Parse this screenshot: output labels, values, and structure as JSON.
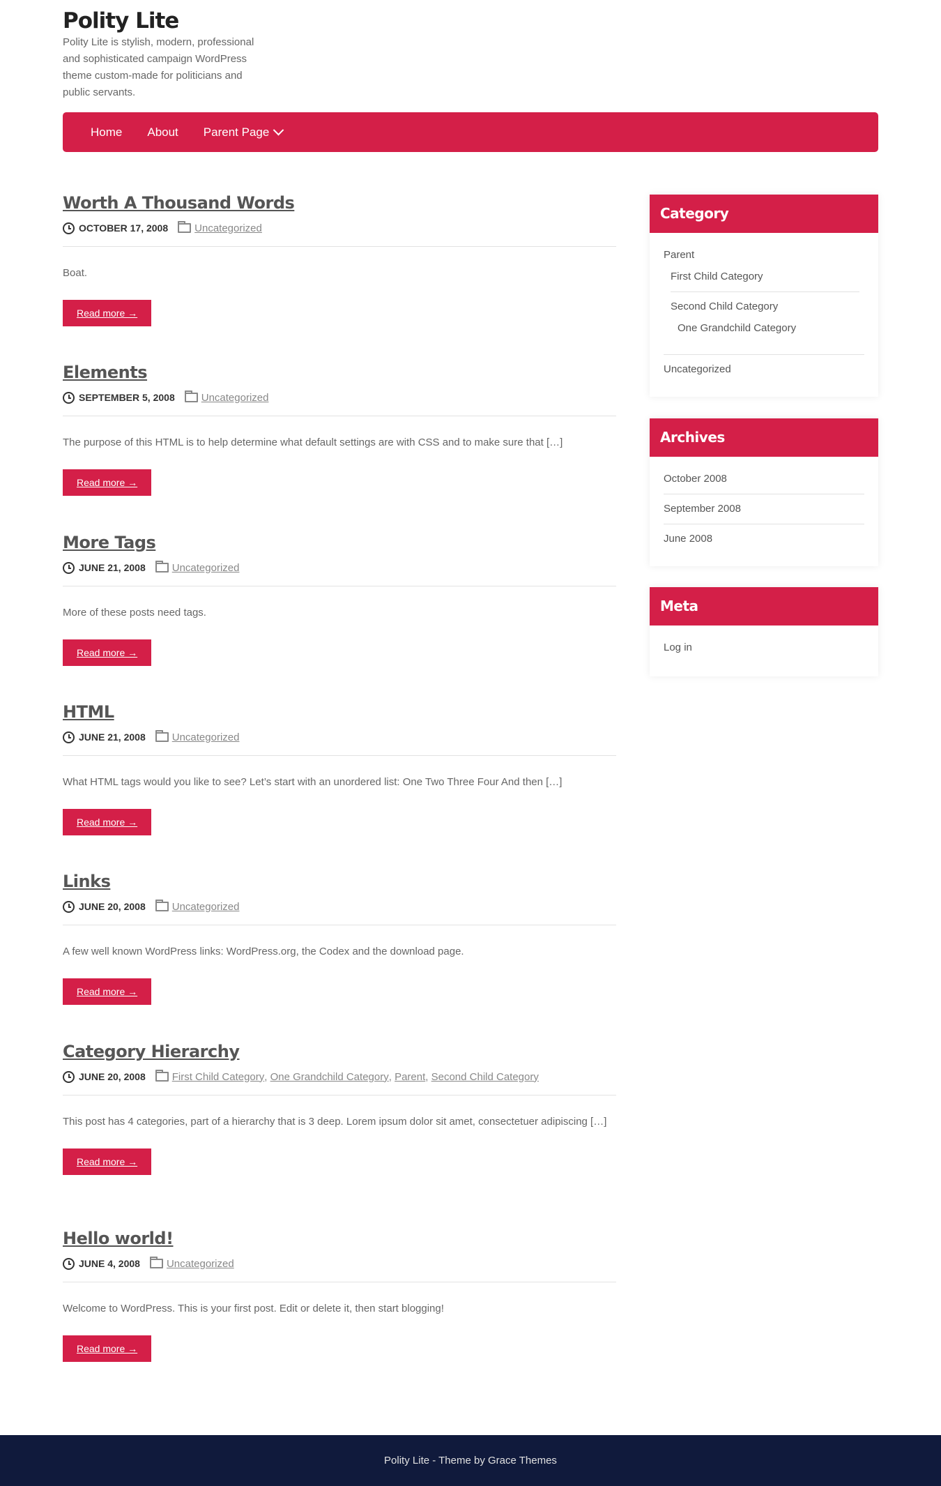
{
  "site": {
    "title": "Polity Lite",
    "description": "Polity Lite is stylish, modern, professional and sophisticated campaign WordPress theme custom-made for politicians and public servants."
  },
  "nav": {
    "items": [
      {
        "label": "Home"
      },
      {
        "label": "About"
      },
      {
        "label": "Parent Page"
      }
    ]
  },
  "posts": [
    {
      "title": "Worth A Thousand Words",
      "date": "OCTOBER 17, 2008",
      "categories": [
        "Uncategorized"
      ],
      "excerpt": "Boat.",
      "read_more": "Read more →"
    },
    {
      "title": "Elements",
      "date": "SEPTEMBER 5, 2008",
      "categories": [
        "Uncategorized"
      ],
      "excerpt": "The purpose of this HTML is to help determine what default settings are with CSS and to make sure that […]",
      "read_more": "Read more →"
    },
    {
      "title": "More Tags",
      "date": "JUNE 21, 2008",
      "categories": [
        "Uncategorized"
      ],
      "excerpt": "More of these posts need tags.",
      "read_more": "Read more →"
    },
    {
      "title": "HTML",
      "date": "JUNE 21, 2008",
      "categories": [
        "Uncategorized"
      ],
      "excerpt": "What HTML tags would you like to see? Let’s start with an unordered list: One Two Three Four And then […]",
      "read_more": "Read more →"
    },
    {
      "title": "Links",
      "date": "JUNE 20, 2008",
      "categories": [
        "Uncategorized"
      ],
      "excerpt": "A few well known WordPress links: WordPress.org, the Codex and the download page.",
      "read_more": "Read more →"
    },
    {
      "title": "Category Hierarchy",
      "date": "JUNE 20, 2008",
      "categories": [
        "First Child Category",
        "One Grandchild Category",
        "Parent",
        "Second Child Category"
      ],
      "excerpt": "This post has 4 categories, part of a hierarchy that is 3 deep. Lorem ipsum dolor sit amet, consectetuer adipiscing […]",
      "read_more": "Read more →"
    },
    {
      "title": "Hello world!",
      "date": "JUNE 4, 2008",
      "categories": [
        "Uncategorized"
      ],
      "excerpt": "Welcome to WordPress. This is your first post. Edit or delete it, then start blogging!",
      "read_more": "Read more →"
    }
  ],
  "sidebar": {
    "category": {
      "title": "Category",
      "parent": "Parent",
      "first_child": "First Child Category",
      "second_child": "Second Child Category",
      "grandchild": "One Grandchild Category",
      "uncategorized": "Uncategorized"
    },
    "archives": {
      "title": "Archives",
      "items": [
        "October 2008",
        "September 2008",
        "June 2008"
      ]
    },
    "meta": {
      "title": "Meta",
      "items": [
        "Log in"
      ]
    }
  },
  "footer": {
    "text": "Polity Lite - Theme by Grace Themes"
  },
  "colors": {
    "accent": "#d41f48",
    "footer_bg": "#101a3c"
  }
}
